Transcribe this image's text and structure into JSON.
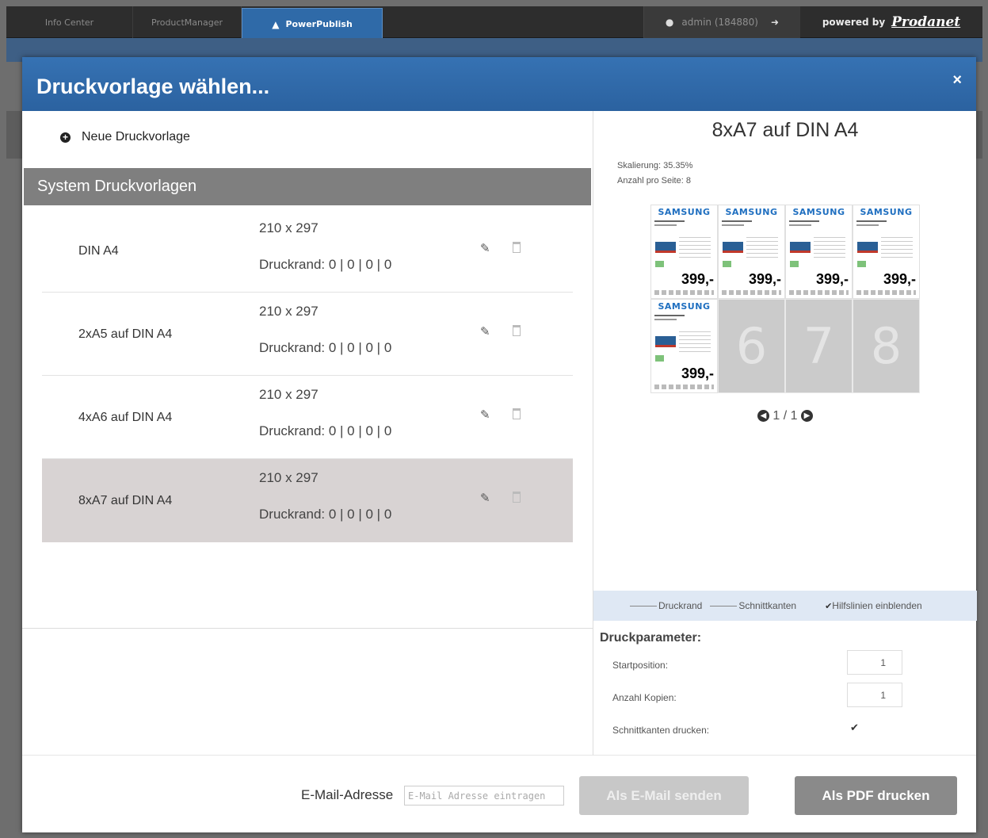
{
  "topbar": {
    "tabs": [
      {
        "label": "Info Center"
      },
      {
        "label": "ProductManager"
      },
      {
        "label": "PowerPublish"
      }
    ],
    "user": "admin (184880)",
    "powered_by": "powered by",
    "brand": "Prodanet"
  },
  "modal": {
    "title": "Druckvorlage wählen...",
    "close": "×"
  },
  "left": {
    "new_template": "Neue Druckvorlage",
    "section_title": "System Druckvorlagen",
    "templates": [
      {
        "name": "DIN A4",
        "size": "210 x 297",
        "margin": "Druckrand: 0 | 0 | 0 | 0"
      },
      {
        "name": "2xA5 auf DIN A4",
        "size": "210 x 297",
        "margin": "Druckrand: 0 | 0 | 0 | 0"
      },
      {
        "name": "4xA6 auf DIN A4",
        "size": "210 x 297",
        "margin": "Druckrand: 0 | 0 | 0 | 0"
      },
      {
        "name": "8xA7 auf DIN A4",
        "size": "210 x 297",
        "margin": "Druckrand: 0 | 0 | 0 | 0",
        "selected": true
      }
    ]
  },
  "preview": {
    "title": "8xA7 auf DIN A4",
    "scaling": "Skalierung: 35.35%",
    "per_page": "Anzahl pro Seite: 8",
    "tile_brand": "SAMSUNG",
    "tile_price": "399,-",
    "empty_slots": [
      "6",
      "7",
      "8"
    ],
    "pager": "1 / 1",
    "legend": {
      "print_margin": "Druckrand",
      "cut_edges": "Schnittkanten",
      "show_guides": "Hilfslinien einblenden",
      "show_guides_checked": true
    }
  },
  "params": {
    "title": "Druckparameter:",
    "start_label": "Startposition:",
    "start_value": "1",
    "copies_label": "Anzahl Kopien:",
    "copies_value": "1",
    "cut_label": "Schnittkanten drucken:",
    "cut_checked": true
  },
  "footer": {
    "email_label": "E-Mail-Adresse",
    "email_placeholder": "E-Mail Adresse eintragen",
    "send_button": "Als E-Mail senden",
    "pdf_button": "Als PDF drucken"
  },
  "colors": {
    "header_blue": "#2f6aa8",
    "section_gray": "#7f7f7f",
    "selected_row": "#d8d3d3"
  }
}
